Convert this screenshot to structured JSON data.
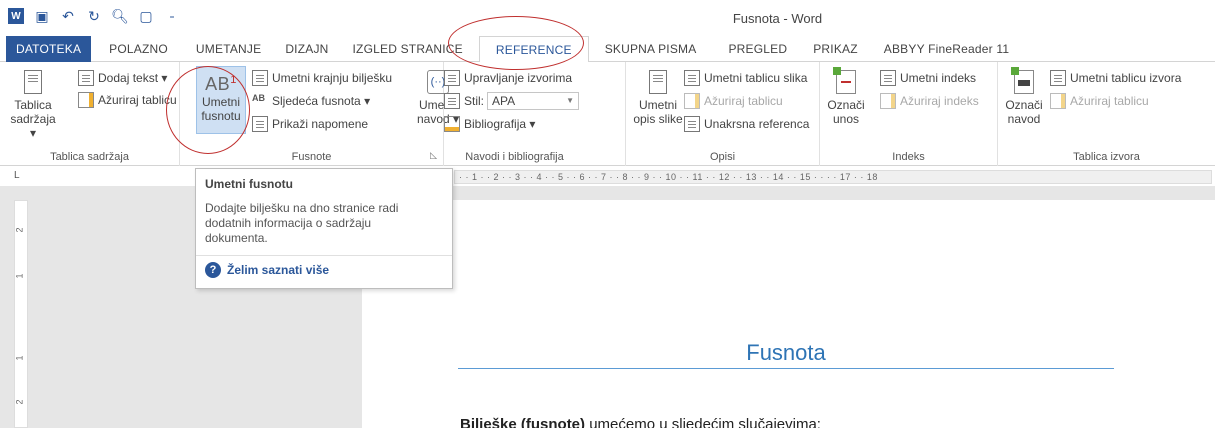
{
  "window": {
    "title": "Fusnota - Word"
  },
  "quick_access": [
    "word-icon",
    "save-icon",
    "undo-icon",
    "redo-icon",
    "print-preview-icon",
    "new-doc-icon",
    "customize-icon"
  ],
  "tabs": [
    {
      "label": "DATOTEKA"
    },
    {
      "label": "POLAZNO"
    },
    {
      "label": "UMETANJE"
    },
    {
      "label": "DIZAJN"
    },
    {
      "label": "IZGLED STRANICE"
    },
    {
      "label": "REFERENCE"
    },
    {
      "label": "SKUPNA PISMA"
    },
    {
      "label": "PREGLED"
    },
    {
      "label": "PRIKAZ"
    },
    {
      "label": "ABBYY FineReader 11"
    }
  ],
  "ribbon": {
    "toc": {
      "group_label": "Tablica sadržaja",
      "big_button": "Tablica sadržaja ▾",
      "add_text": "Dodaj tekst ▾",
      "update_table": "Ažuriraj tablicu"
    },
    "footnotes": {
      "group_label": "Fusnote",
      "big_button": "Umetni fusnotu",
      "big_icon_text": "AB",
      "insert_endnote": "Umetni krajnju bilješku",
      "next_footnote": "Sljedeća fusnota ▾",
      "show_notes": "Prikaži napomene"
    },
    "citations": {
      "group_label": "Navodi i bibliografija",
      "big_button": "Umetni navod ▾",
      "manage_sources": "Upravljanje izvorima",
      "style_label": "Stil:",
      "style_value": "APA",
      "bibliography": "Bibliografija ▾"
    },
    "captions": {
      "group_label": "Opisi",
      "big_button": "Umetni opis slike",
      "insert_table_figures": "Umetni tablicu slika",
      "update_table": "Ažuriraj tablicu",
      "cross_reference": "Unakrsna referenca"
    },
    "index": {
      "group_label": "Indeks",
      "big_button": "Označi unos",
      "insert_index": "Umetni indeks",
      "update_index": "Ažuriraj indeks"
    },
    "authorities": {
      "group_label": "Tablica izvora",
      "big_button": "Označi navod",
      "insert_table": "Umetni tablicu izvora",
      "update_table": "Ažuriraj tablicu"
    }
  },
  "ruler": {
    "corner": "L",
    "marks": "·  ·  1  ·  ·  2  ·  ·  3  ·  ·  4  ·  ·  5  ·  ·  6  ·  ·  7  ·  ·  8  ·  ·  9  ·  ·  10  ·  ·  11  ·  ·  12  ·  ·  13  ·  ·  14  ·  ·  15  ·  ·  ·  ·  17  ·  ·  18",
    "vertical_marks": [
      "2",
      "1",
      "1",
      "2"
    ]
  },
  "tooltip": {
    "title": "Umetni fusnotu",
    "description": "Dodajte bilješku na dno stranice radi dodatnih informacija o sadržaju dokumenta.",
    "link": "Želim saznati više"
  },
  "document": {
    "heading": "Fusnota",
    "para_bold": "Bilješke (fusnote)",
    "para_rest": " umećemo u sljedećim slučajevima:"
  },
  "colors": {
    "accent": "#2b579a",
    "heading": "#2e74b5",
    "annotation": "#c0302f"
  }
}
